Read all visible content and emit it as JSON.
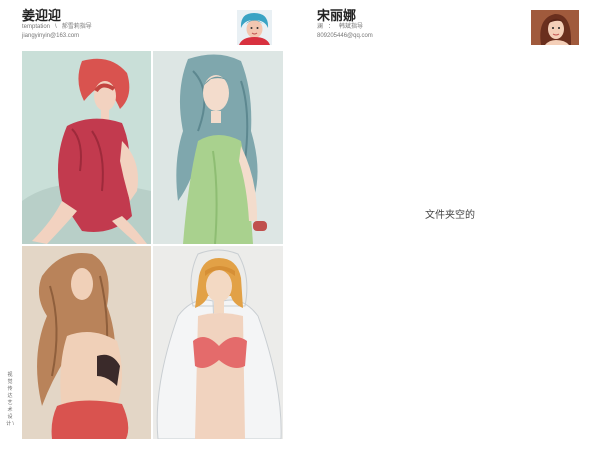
{
  "left": {
    "name": "姜迎迎",
    "team": "temptation",
    "separator": "\\",
    "role": "郝雪莉指导",
    "email": "jiangyinyin@163.com",
    "caption": "视觉传达艺术设计 \\"
  },
  "right": {
    "name": "宋丽娜",
    "team": "澜",
    "separator": "：",
    "role": "韩斌指导",
    "email": "809205446@qq.com",
    "empty_message": "文件夹空的"
  },
  "colors": {
    "tile1_bg": "#c9dfd8",
    "tile2_bg": "#dde6e4",
    "tile3_bg": "#e3d6c6",
    "tile4_bg": "#ececea"
  }
}
